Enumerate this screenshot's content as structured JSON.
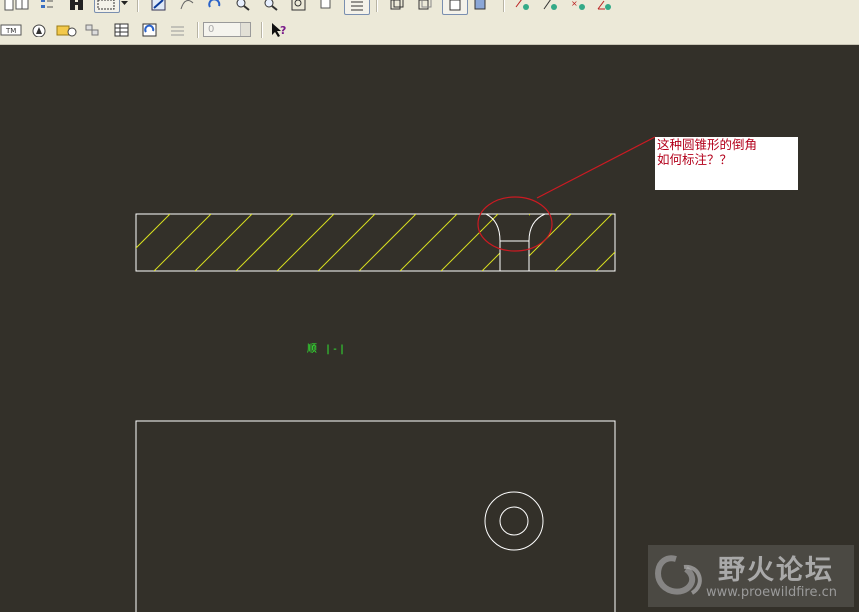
{
  "toolbar": {
    "row1_icons": [
      "sheet-icon",
      "view-icon",
      "layer-icon",
      "binoculars-icon",
      "selection-box-icon",
      "sketch-icon",
      "curve-icon",
      "regenerate-icon",
      "zoom-in-icon",
      "zoom-out-icon",
      "zoom-fit-icon",
      "orient-icon",
      "layers-icon",
      "wireframe-icon",
      "hidden-line-icon",
      "no-hidden-icon",
      "shading-icon",
      "datum-plane-icon",
      "datum-axis-icon",
      "datum-point-icon",
      "datum-csys-icon"
    ],
    "row2_icons": [
      "dim-toggle-icon",
      "cone-icon",
      "open-folder-icon",
      "model-tree-icon",
      "table-icon",
      "refresh-icon",
      "grid-icon",
      "help-icon"
    ],
    "spin_value": "0",
    "dim_label": "TM"
  },
  "annotation": {
    "note_text": "这种圆锥形的倒角\n如何标注？？"
  },
  "section_label": "顺 |-|",
  "watermark": {
    "title": "野火论坛",
    "url": "www.proewildfire.cn"
  },
  "colors": {
    "canvas_bg": "#333029",
    "hatch": "#d9e020",
    "outline": "#ffffff",
    "highlight": "#cc1a22",
    "note_text": "#b3001b",
    "section_label": "#33ff33"
  }
}
